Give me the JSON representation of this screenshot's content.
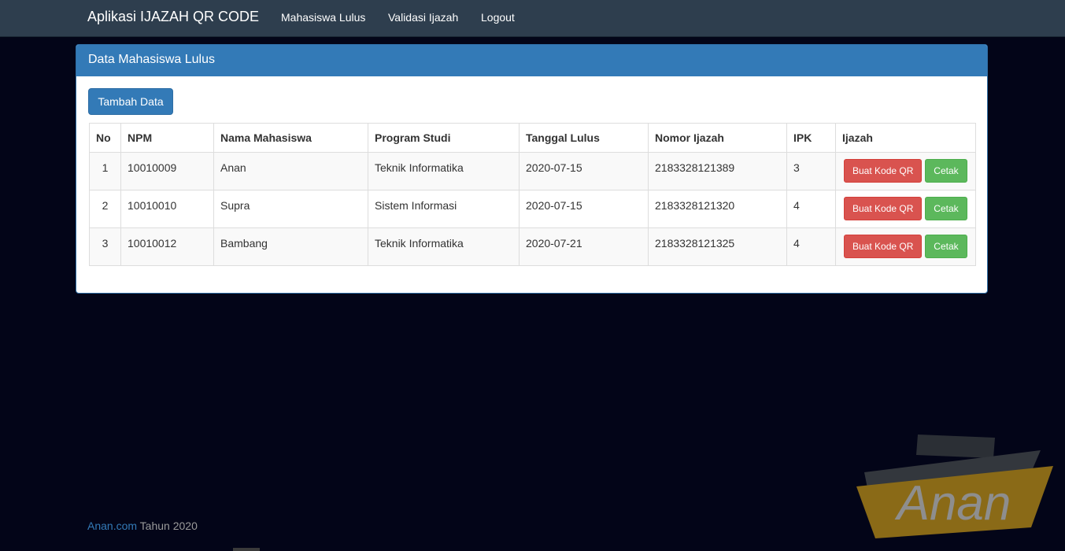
{
  "navbar": {
    "brand": "Aplikasi IJAZAH QR CODE",
    "links": [
      "Mahasiswa Lulus",
      "Validasi Ijazah",
      "Logout"
    ]
  },
  "panel": {
    "title": "Data Mahasiswa Lulus",
    "add_button": "Tambah Data"
  },
  "table": {
    "headers": [
      "No",
      "NPM",
      "Nama Mahasiswa",
      "Program Studi",
      "Tanggal Lulus",
      "Nomor Ijazah",
      "IPK",
      "Ijazah"
    ],
    "rows": [
      {
        "no": "1",
        "npm": "10010009",
        "nama": "Anan",
        "prodi": "Teknik Informatika",
        "tanggal": "2020-07-15",
        "nomor": "2183328121389",
        "ipk": "3"
      },
      {
        "no": "2",
        "npm": "10010010",
        "nama": "Supra",
        "prodi": "Sistem Informasi",
        "tanggal": "2020-07-15",
        "nomor": "2183328121320",
        "ipk": "4"
      },
      {
        "no": "3",
        "npm": "10010012",
        "nama": "Bambang",
        "prodi": "Teknik Informatika",
        "tanggal": "2020-07-21",
        "nomor": "2183328121325",
        "ipk": "4"
      }
    ],
    "qr_button": "Buat Kode QR",
    "print_button": "Cetak"
  },
  "footer": {
    "site": "Anan.com",
    "text": " Tahun 2020"
  },
  "watermark": {
    "text": "Anan"
  },
  "colors": {
    "background": "#030518",
    "navbar": "#2e3e4e",
    "primary": "#337ab7",
    "danger": "#d9534f",
    "success": "#5cb85c"
  }
}
